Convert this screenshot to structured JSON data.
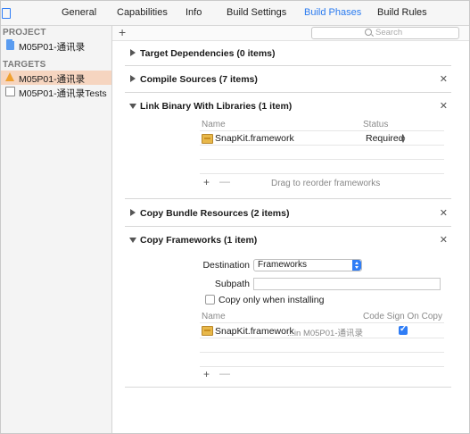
{
  "tabs": [
    "General",
    "Capabilities",
    "Info",
    "Build Settings",
    "Build Phases",
    "Build Rules"
  ],
  "active_tab": "Build Phases",
  "sidebar": {
    "project_header": "PROJECT",
    "project_item": "M05P01-通讯录",
    "targets_header": "TARGETS",
    "targets": [
      "M05P01-通讯录",
      "M05P01-通讯录Tests"
    ],
    "selected_target": "M05P01-通讯录"
  },
  "toolbar": {
    "add_label": "+",
    "search_placeholder": "Search"
  },
  "phases": {
    "target_dependencies": "Target Dependencies (0 items)",
    "compile_sources": "Compile Sources (7 items)",
    "link_binary": {
      "title": "Link Binary With Libraries (1 item)",
      "col_name": "Name",
      "col_status": "Status",
      "rows": [
        {
          "name": "SnapKit.framework",
          "status": "Required"
        }
      ],
      "footer_add": "+",
      "footer_remove": "—",
      "footer_hint": "Drag to reorder frameworks"
    },
    "copy_bundle": "Copy Bundle Resources (2 items)",
    "copy_frameworks": {
      "title": "Copy Frameworks (1 item)",
      "destination_label": "Destination",
      "destination_value": "Frameworks",
      "subpath_label": "Subpath",
      "subpath_value": "",
      "copy_only_label": "Copy only when installing",
      "col_name": "Name",
      "col_codesign": "Code Sign On Copy",
      "rows": [
        {
          "name": "SnapKit.framework",
          "path": "...in M05P01-通讯录",
          "code_sign": true
        }
      ],
      "footer_add": "+",
      "footer_remove": "—"
    }
  },
  "colors": {
    "accent": "#2f7df6",
    "selection": "#f6d5c0"
  }
}
